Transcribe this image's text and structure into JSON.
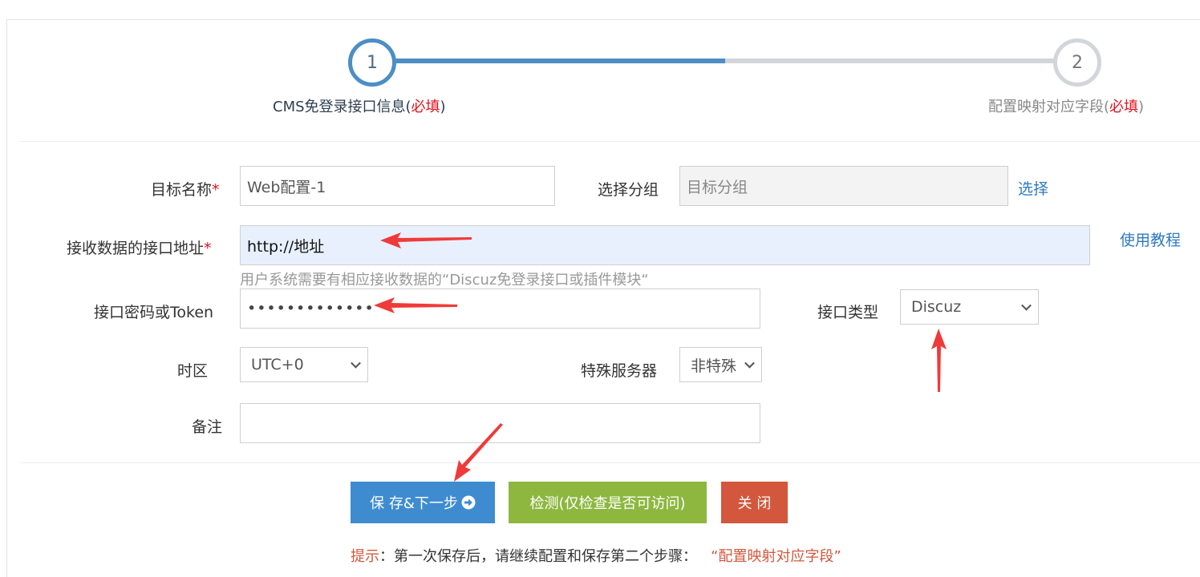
{
  "steps": [
    {
      "number": "1",
      "label": "CMS免登录接口信息(",
      "required": "必填",
      "close": ")"
    },
    {
      "number": "2",
      "label": "配置映射对应字段(",
      "required": "必填",
      "close": ")"
    }
  ],
  "form": {
    "target_name": {
      "label": "目标名称",
      "star": "*",
      "value": "Web配置-1"
    },
    "group": {
      "label": "选择分组",
      "placeholder": "目标分组",
      "link": "选择"
    },
    "endpoint": {
      "label": "接收数据的接口地址",
      "star": "*",
      "value": "http://地址",
      "help": "使用教程",
      "hint": "用户系统需要有相应接收数据的“Discuz免登录接口或插件模块“"
    },
    "token": {
      "label": "接口密码或Token",
      "value": "•••••••••••••"
    },
    "api_type": {
      "label": "接口类型",
      "value": "Discuz"
    },
    "timezone": {
      "label": "时区",
      "value": "UTC+0"
    },
    "special_server": {
      "label": "特殊服务器",
      "value": "非特殊"
    },
    "remark": {
      "label": "备注",
      "value": ""
    }
  },
  "buttons": {
    "save": "保 存&下一步",
    "check": "检测(仅检查是否可访问)",
    "close": "关 闭"
  },
  "tip": {
    "prefix": "提示",
    "body": "：第一次保存后，请继续配置和保存第二个步骤：",
    "highlight": "“配置映射对应字段”"
  },
  "colors": {
    "primary": "#3e8ccf",
    "success": "#8db73f",
    "danger": "#d2573c",
    "annotation_arrow": "#f03a3a"
  }
}
